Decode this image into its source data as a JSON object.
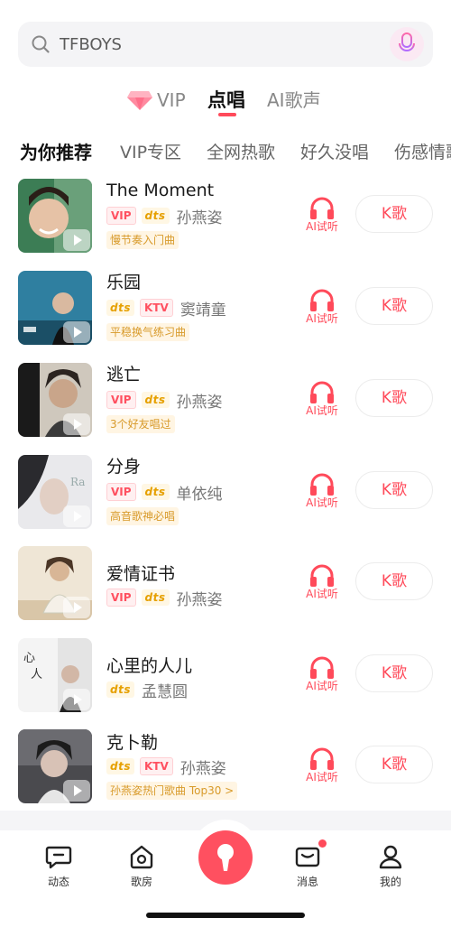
{
  "search": {
    "value": "TFBOYS"
  },
  "mode_tabs": [
    {
      "label": "VIP"
    },
    {
      "label": "点唱"
    },
    {
      "label": "AI歌声"
    }
  ],
  "categories": [
    "为你推荐",
    "VIP专区",
    "全网热歌",
    "好久没唱",
    "伤感情歌"
  ],
  "songs": [
    {
      "title": "The Moment",
      "badges": [
        "VIP",
        "dts"
      ],
      "artist": "孙燕姿",
      "tip": "慢节奏入门曲"
    },
    {
      "title": "乐园",
      "badges": [
        "dts",
        "KTV"
      ],
      "artist": "窦靖童",
      "tip": "平稳换气练习曲"
    },
    {
      "title": "逃亡",
      "badges": [
        "VIP",
        "dts"
      ],
      "artist": "孙燕姿",
      "tip": "3个好友唱过"
    },
    {
      "title": "分身",
      "badges": [
        "VIP",
        "dts"
      ],
      "artist": "单依纯",
      "tip": "高音歌神必唱"
    },
    {
      "title": "爱情证书",
      "badges": [
        "VIP",
        "dts"
      ],
      "artist": "孙燕姿",
      "tip": ""
    },
    {
      "title": "心里的人儿",
      "badges": [
        "dts"
      ],
      "artist": "孟慧圆",
      "tip": ""
    },
    {
      "title": "克卜勒",
      "badges": [
        "dts",
        "KTV"
      ],
      "artist": "孙燕姿",
      "tip": "孙燕姿热门歌曲 Top30 >"
    }
  ],
  "song_actions": {
    "ai_listen": "AI试听",
    "karaoke": "K歌"
  },
  "bottom_nav": {
    "feed": "动态",
    "room": "歌房",
    "messages": "消息",
    "mine": "我的"
  },
  "colors": {
    "accent": "#ff4a5a",
    "gold": "#e6a000"
  }
}
